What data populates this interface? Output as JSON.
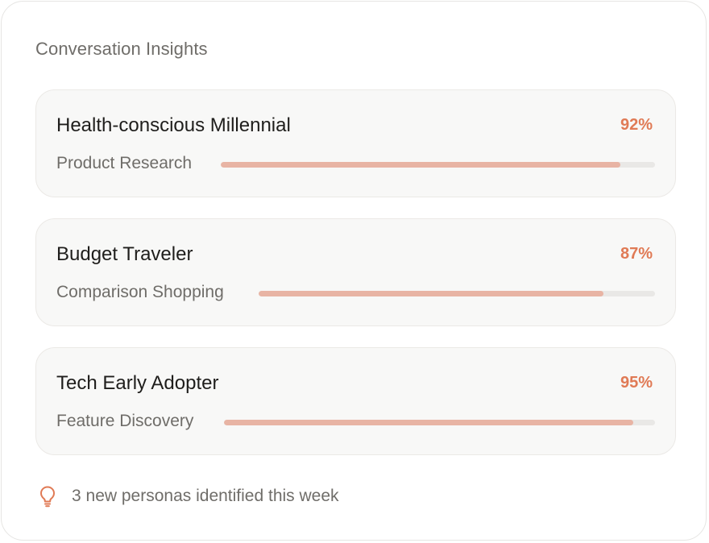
{
  "card": {
    "title": "Conversation Insights"
  },
  "personas": [
    {
      "name": "Health-conscious Millennial",
      "match": "92%",
      "match_value": 92,
      "activity": "Product Research"
    },
    {
      "name": "Budget Traveler",
      "match": "87%",
      "match_value": 87,
      "activity": "Comparison Shopping"
    },
    {
      "name": "Tech Early Adopter",
      "match": "95%",
      "match_value": 95,
      "activity": "Feature Discovery"
    }
  ],
  "footer": {
    "icon": "lightbulb-icon",
    "text": "3 new personas identified this week"
  },
  "colors": {
    "accent": "#e07a55",
    "bar_fill": "#e8b4a4",
    "bar_track": "#e9e8e6"
  }
}
